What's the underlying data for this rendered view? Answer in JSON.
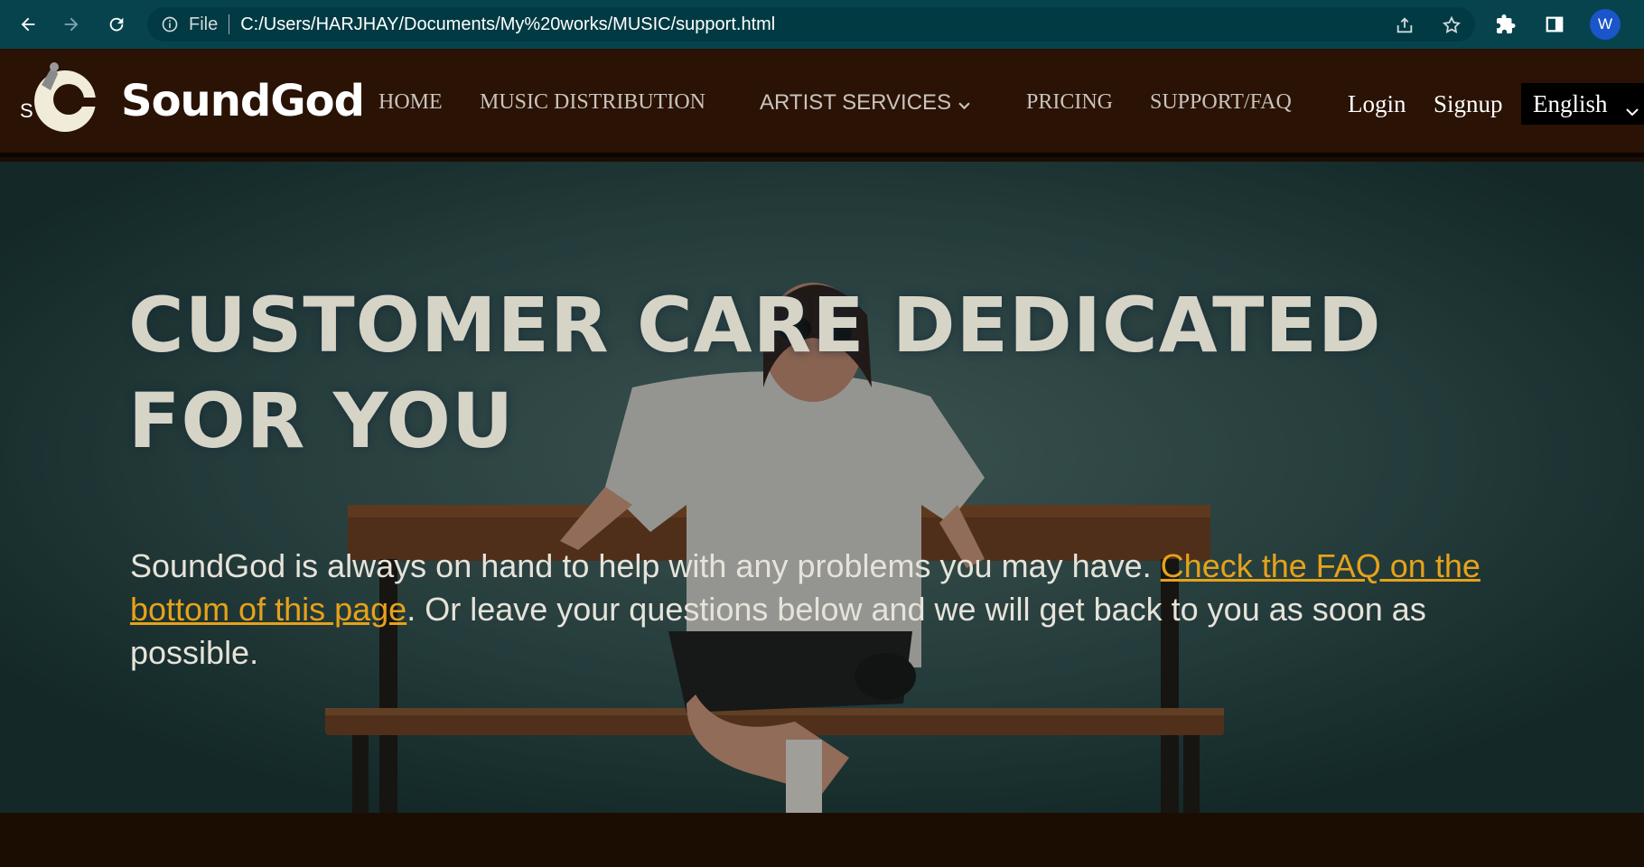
{
  "browser": {
    "scheme_label": "File",
    "url": "C:/Users/HARJHAY/Documents/My%20works/MUSIC/support.html",
    "profile_initial": "W",
    "icons": [
      "back-arrow-icon",
      "forward-arrow-icon",
      "reload-icon",
      "info-icon",
      "share-icon",
      "star-icon",
      "extensions-icon",
      "side-panel-icon",
      "more-vert-icon"
    ]
  },
  "site": {
    "logo_letter": "S",
    "brand": "SoundGod",
    "menu": {
      "home": "HOME",
      "distribution": "MUSIC DISTRIBUTION",
      "artist_services": "ARTIST SERVICES",
      "pricing": "PRICING",
      "support": "SUPPORT/FAQ"
    },
    "auth": {
      "login": "Login",
      "signup": "Signup"
    },
    "language": {
      "selected": "English"
    }
  },
  "hero": {
    "title": "CUSTOMER CARE DEDICATED FOR YOU",
    "text_before": "SoundGod is always on hand to help with any problems you may have. ",
    "faq_link": "Check the FAQ on the bottom of this page",
    "text_after": ". Or leave your questions below and we will get back to you as soon as possible."
  },
  "colors": {
    "chrome": "#06434d",
    "header": "#2a1204",
    "link": "#e6a21a",
    "title": "#d6d4c6"
  }
}
